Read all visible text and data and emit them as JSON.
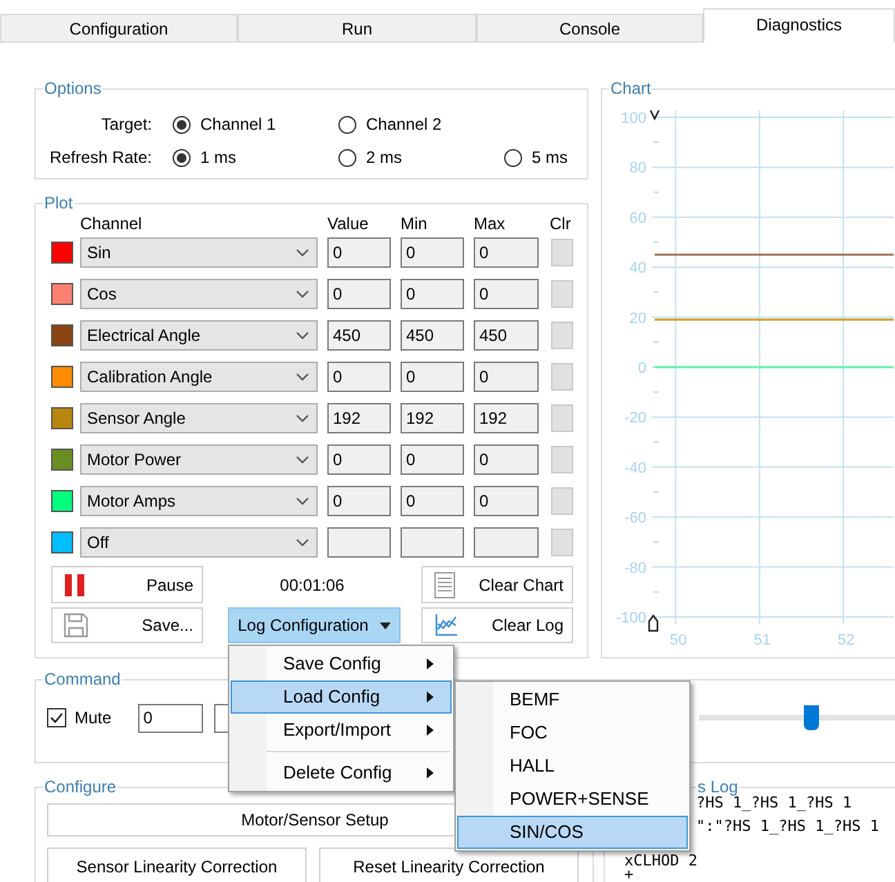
{
  "tabs": [
    {
      "label": "Configuration",
      "selected": false
    },
    {
      "label": "Run",
      "selected": false
    },
    {
      "label": "Console",
      "selected": false
    },
    {
      "label": "Diagnostics",
      "selected": true
    }
  ],
  "options": {
    "title": "Options",
    "rows": [
      {
        "label": "Target:",
        "choices": [
          {
            "label": "Channel 1",
            "selected": true
          },
          {
            "label": "Channel 2",
            "selected": false
          }
        ]
      },
      {
        "label": "Refresh Rate:",
        "choices": [
          {
            "label": "1 ms",
            "selected": true
          },
          {
            "label": "2 ms",
            "selected": false
          },
          {
            "label": "5 ms",
            "selected": false
          }
        ]
      }
    ]
  },
  "plot": {
    "title": "Plot",
    "columns": [
      "Channel",
      "Value",
      "Min",
      "Max",
      "Clr"
    ],
    "rows": [
      {
        "color": "#ff0000",
        "channel": "Sin",
        "value": "0",
        "min": "0",
        "max": "0"
      },
      {
        "color": "#fa8072",
        "channel": "Cos",
        "value": "0",
        "min": "0",
        "max": "0"
      },
      {
        "color": "#8b4513",
        "channel": "Electrical Angle",
        "value": "450",
        "min": "450",
        "max": "450"
      },
      {
        "color": "#ff8c00",
        "channel": "Calibration Angle",
        "value": "0",
        "min": "0",
        "max": "0"
      },
      {
        "color": "#b8860b",
        "channel": "Sensor Angle",
        "value": "192",
        "min": "192",
        "max": "192"
      },
      {
        "color": "#6b8e23",
        "channel": "Motor Power",
        "value": "0",
        "min": "0",
        "max": "0"
      },
      {
        "color": "#00ff7f",
        "channel": "Motor Amps",
        "value": "0",
        "min": "0",
        "max": "0"
      },
      {
        "color": "#00bfff",
        "channel": "Off"
      }
    ],
    "pause_button": "Pause",
    "timer": "00:01:06",
    "clear_chart_button": "Clear Chart",
    "save_button": "Save...",
    "log_config_button": {
      "label": "Log Configuration",
      "active": true
    },
    "clear_log_button": "Clear Log"
  },
  "chart": {
    "title": "Chart",
    "chart_data": {
      "type": "line",
      "xlim": [
        49.75,
        52.6
      ],
      "ylim": [
        -100,
        100
      ],
      "xticks": [
        50,
        51,
        52
      ],
      "yticks": [
        100,
        80,
        60,
        40,
        20,
        0,
        -20,
        -40,
        -60,
        -80,
        -100
      ],
      "grid": true,
      "x": [
        49.75,
        52.6
      ],
      "series": [
        {
          "color": "#a0704e",
          "values": [
            45,
            45
          ]
        },
        {
          "color": "#d4a030",
          "values": [
            19,
            19
          ]
        },
        {
          "color": "#5cf5a8",
          "values": [
            0,
            0
          ]
        }
      ]
    }
  },
  "command": {
    "title": "Command",
    "mute": {
      "label": "Mute",
      "checked": true
    },
    "input_value": "0",
    "slider": {
      "level": 0.57
    }
  },
  "configure": {
    "title": "Configure",
    "buttons": [
      "Motor/Sensor Setup",
      "Sensor Linearity Correction",
      "Reset Linearity Correction"
    ]
  },
  "log": {
    "title": "s Log",
    "lines": [
      {
        "text": "?HS 1_?HS 1_?HS 1",
        "indented": true
      },
      {
        "text": "\":\"?HS 1_?HS 1_?HS 1",
        "indented": true
      },
      {
        "text": "xCLHOD 2",
        "indented": false
      },
      {
        "text": "+",
        "indented": false
      }
    ]
  },
  "menu": {
    "items": [
      {
        "kind": "item",
        "label": "Save Config",
        "selected": false
      },
      {
        "kind": "item",
        "label": "Load Config",
        "selected": true
      },
      {
        "kind": "item",
        "label": "Export/Import",
        "selected": false
      },
      {
        "kind": "separator"
      },
      {
        "kind": "item",
        "label": "Delete Config",
        "selected": false
      }
    ],
    "submenu": [
      {
        "label": "BEMF",
        "selected": false
      },
      {
        "label": "FOC",
        "selected": false
      },
      {
        "label": "HALL",
        "selected": false
      },
      {
        "label": "POWER+SENSE",
        "selected": false
      },
      {
        "label": "SIN/COS",
        "selected": true
      }
    ]
  }
}
